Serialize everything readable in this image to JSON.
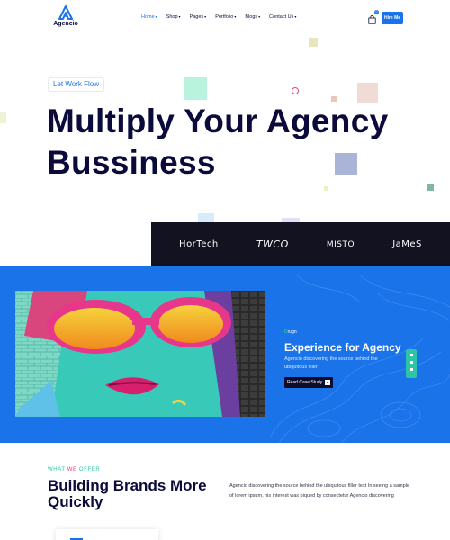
{
  "brand": {
    "name": "Agencio"
  },
  "nav": {
    "items": [
      {
        "label": "Home",
        "active": true
      },
      {
        "label": "Shop",
        "active": false
      },
      {
        "label": "Pages",
        "active": false
      },
      {
        "label": "Portfolio",
        "active": false
      },
      {
        "label": "Blogs",
        "active": false
      },
      {
        "label": "Contact Us",
        "active": false
      }
    ],
    "cart_count": "0",
    "hire_label": "Hire Me"
  },
  "hero": {
    "tag": "Let Work Flow",
    "title_line1": "Multiply Your Agency",
    "title_line2": "Bussiness"
  },
  "brands": [
    "HorTech",
    "TWCO",
    "MISTO",
    "JaMeS"
  ],
  "feature": {
    "category": "Drugn",
    "title": "Experience for Agency",
    "description": "Agencio discovering the source behind the ubiquitous filler",
    "button_label": "Read Case Study"
  },
  "offer": {
    "eyebrow_prefix": "WHAT ",
    "eyebrow_accent": "WE",
    "eyebrow_suffix": " OFFER",
    "title": "Building Brands More Quickly",
    "description": "Agencio discovering the source behind the ubiquitous filler text In seeing a sample of lorem ipsum, his interest was piqued by consectetur Agencio discovering"
  },
  "colors": {
    "primary": "#1a73e8",
    "navy": "#0b0b3b",
    "strip": "#121221",
    "teal": "#2ec4a6",
    "pink": "#e0457b"
  }
}
